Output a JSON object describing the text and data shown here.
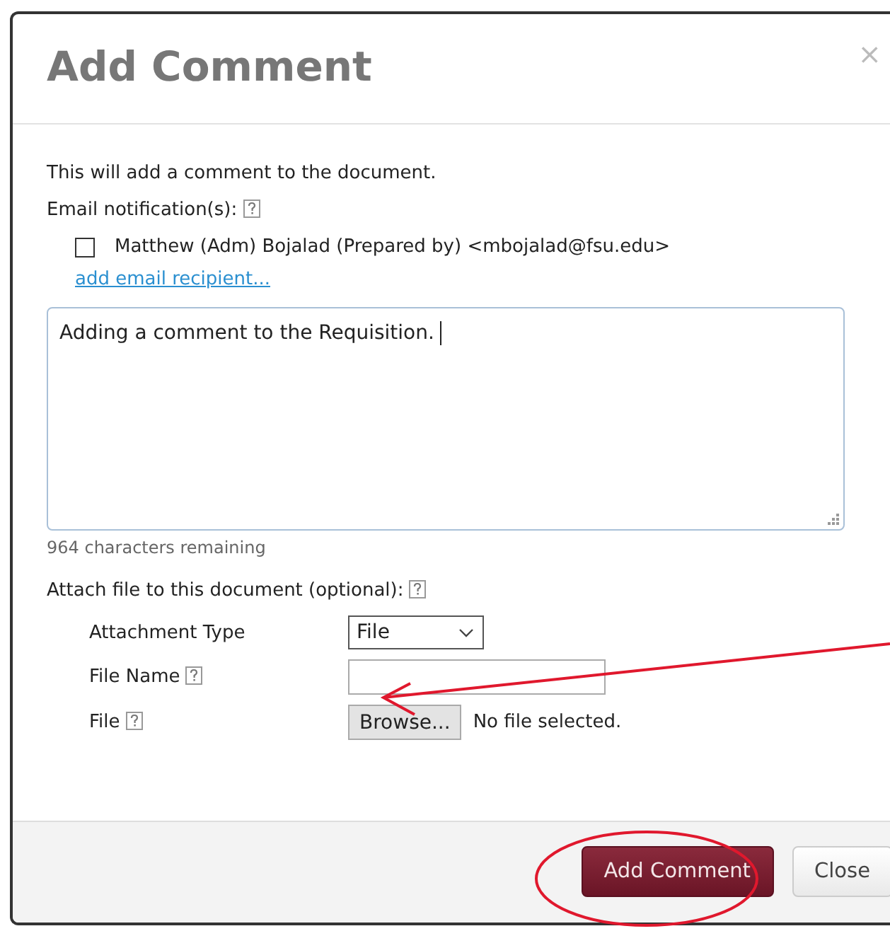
{
  "dialog": {
    "title": "Add Comment",
    "close_icon": "×"
  },
  "intro": "This will add a comment to the document.",
  "email": {
    "label": "Email notification(s):",
    "recipients": [
      {
        "label": "Matthew (Adm) Bojalad (Prepared by) <mbojalad@fsu.edu>",
        "checked": false
      }
    ],
    "add_link": "add email recipient..."
  },
  "comment": {
    "value": "Adding a comment to the Requisition.",
    "remaining": "964 characters remaining"
  },
  "attach": {
    "label": "Attach file to this document (optional):",
    "fields": [
      {
        "kind": "select",
        "label": "Attachment Type",
        "help": false,
        "value": "File"
      },
      {
        "kind": "text",
        "label": "File Name",
        "help": true
      },
      {
        "kind": "file",
        "label": "File",
        "help": true,
        "button": "Browse...",
        "status": "No file selected."
      }
    ]
  },
  "buttons": [
    {
      "label": "Add Comment",
      "kind": "primary"
    },
    {
      "label": "Close",
      "kind": "secondary"
    }
  ],
  "annotations": {
    "arrow": true,
    "ellipse": true
  }
}
